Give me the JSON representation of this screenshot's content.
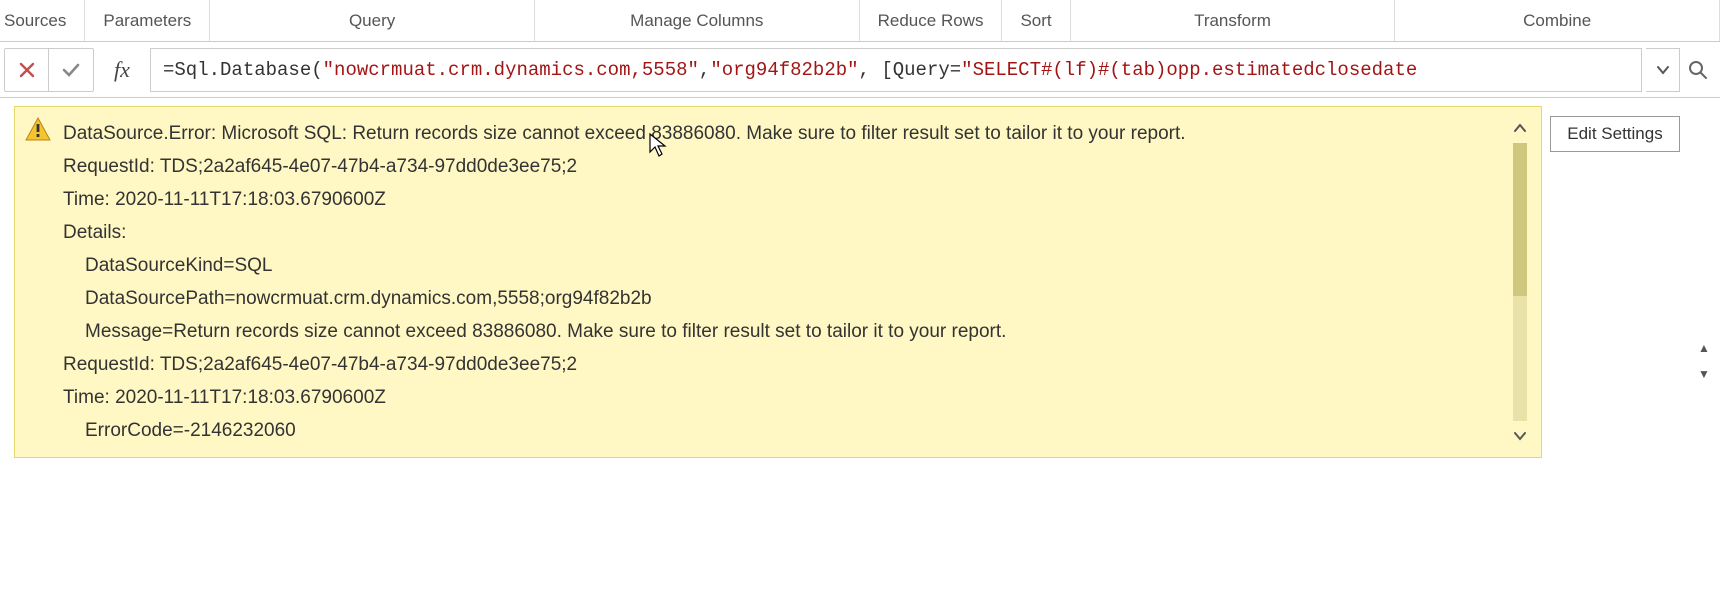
{
  "ribbon": {
    "groups": [
      "Sources",
      "Parameters",
      "Query",
      "Manage Columns",
      "Reduce Rows",
      "Sort",
      "Transform",
      "Combine"
    ]
  },
  "formula_bar": {
    "fx_label": "fx",
    "prefix": "=",
    "plain": " Sql.Database(",
    "s1": "\"nowcrmuat.crm.dynamics.com,5558\"",
    "c1": ", ",
    "s2": "\"org94f82b2b\"",
    "c2": ", [Query=",
    "s3": "\"SELECT#(lf)#(tab)opp.estimatedclosedate"
  },
  "error": {
    "line1": "DataSource.Error: Microsoft SQL: Return records size cannot exceed 83886080. Make sure to filter result set to tailor it to your report.",
    "line2": "RequestId: TDS;2a2af645-4e07-47b4-a734-97dd0de3ee75;2",
    "line3": "Time: 2020-11-11T17:18:03.6790600Z",
    "line4": "Details:",
    "line5": "DataSourceKind=SQL",
    "line6": "DataSourcePath=nowcrmuat.crm.dynamics.com,5558;org94f82b2b",
    "line7": "Message=Return records size cannot exceed 83886080. Make sure to filter result set to tailor it to your report.",
    "line8": "RequestId: TDS;2a2af645-4e07-47b4-a734-97dd0de3ee75;2",
    "line9": "Time: 2020-11-11T17:18:03.6790600Z",
    "line10": "ErrorCode=-2146232060"
  },
  "buttons": {
    "edit_settings": "Edit Settings"
  }
}
